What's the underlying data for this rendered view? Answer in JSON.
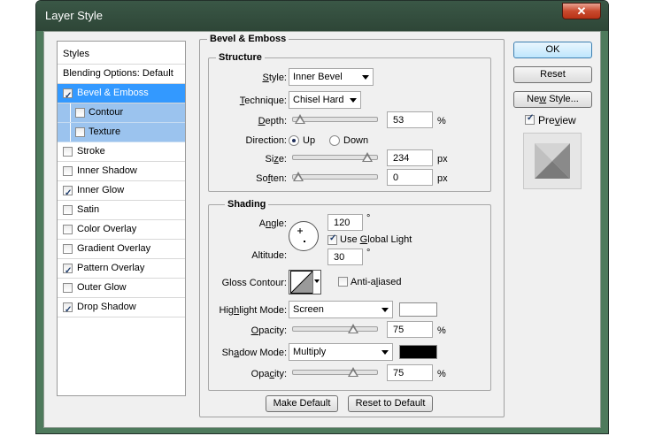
{
  "window": {
    "title": "Layer Style",
    "close_label": "✕"
  },
  "sidebar": {
    "header": "Styles",
    "blending": "Blending Options: Default",
    "items": [
      {
        "label": "Bevel & Emboss",
        "checked": true
      },
      {
        "label": "Contour",
        "checked": false
      },
      {
        "label": "Texture",
        "checked": false
      },
      {
        "label": "Stroke",
        "checked": false
      },
      {
        "label": "Inner Shadow",
        "checked": false
      },
      {
        "label": "Inner Glow",
        "checked": true
      },
      {
        "label": "Satin",
        "checked": false
      },
      {
        "label": "Color Overlay",
        "checked": false
      },
      {
        "label": "Gradient Overlay",
        "checked": false
      },
      {
        "label": "Pattern Overlay",
        "checked": true
      },
      {
        "label": "Outer Glow",
        "checked": false
      },
      {
        "label": "Drop Shadow",
        "checked": true
      }
    ]
  },
  "bevel": {
    "title": "Bevel & Emboss",
    "structure": {
      "title": "Structure",
      "style": {
        "label_pre": "",
        "label_u": "S",
        "label_post": "tyle:",
        "value": "Inner Bevel"
      },
      "technique": {
        "label_pre": "",
        "label_u": "T",
        "label_post": "echnique:",
        "value": "Chisel Hard"
      },
      "depth": {
        "label_pre": "",
        "label_u": "D",
        "label_post": "epth:",
        "value": "53",
        "unit": "%",
        "level": 0.03
      },
      "direction": {
        "label": "Direction:",
        "up": "Up",
        "down": "Down",
        "selected": "up"
      },
      "size": {
        "label_pre": "Si",
        "label_u": "z",
        "label_post": "e:",
        "value": "234",
        "unit": "px",
        "level": 0.94
      },
      "soften": {
        "label_pre": "So",
        "label_u": "f",
        "label_post": "ten:",
        "value": "0",
        "unit": "px",
        "level": 0.0
      }
    },
    "shading": {
      "title": "Shading",
      "angle": {
        "label_pre": "A",
        "label_u": "n",
        "label_post": "gle:",
        "value": "120",
        "unit": "°"
      },
      "global_light": {
        "label_pre": "Use ",
        "label_u": "G",
        "label_post": "lobal Light",
        "checked": true
      },
      "altitude": {
        "label": "Altitude:",
        "value": "30",
        "unit": "°"
      },
      "gloss_contour": {
        "label": "Gloss Contour:",
        "anti_pre": "Anti-a",
        "anti_u": "l",
        "anti_post": "iased",
        "anti_checked": false
      },
      "highlight_mode": {
        "label_pre": "Hig",
        "label_u": "h",
        "label_post": "light Mode:",
        "value": "Screen",
        "color": "#ffffff"
      },
      "highlight_opacity": {
        "label_pre": "",
        "label_u": "O",
        "label_post": "pacity:",
        "value": "75",
        "unit": "%",
        "level": 0.75
      },
      "shadow_mode": {
        "label_pre": "Sh",
        "label_u": "a",
        "label_post": "dow Mode:",
        "value": "Multiply",
        "color": "#000000"
      },
      "shadow_opacity": {
        "label_pre": "Opa",
        "label_u": "c",
        "label_post": "ity:",
        "value": "75",
        "unit": "%",
        "level": 0.75
      }
    },
    "make_default": "Make Default",
    "reset_default": "Reset to Default"
  },
  "buttons": {
    "ok": "OK",
    "reset": "Reset",
    "new_style_pre": "Ne",
    "new_style_u": "w",
    "new_style_post": " Style...",
    "preview_pre": "Pre",
    "preview_u": "v",
    "preview_post": "iew",
    "preview_checked": true
  },
  "colors": {
    "selected_row": "#3399ff",
    "sub_row": "#9bc3ee",
    "window_frame": "#4e7a5c"
  }
}
